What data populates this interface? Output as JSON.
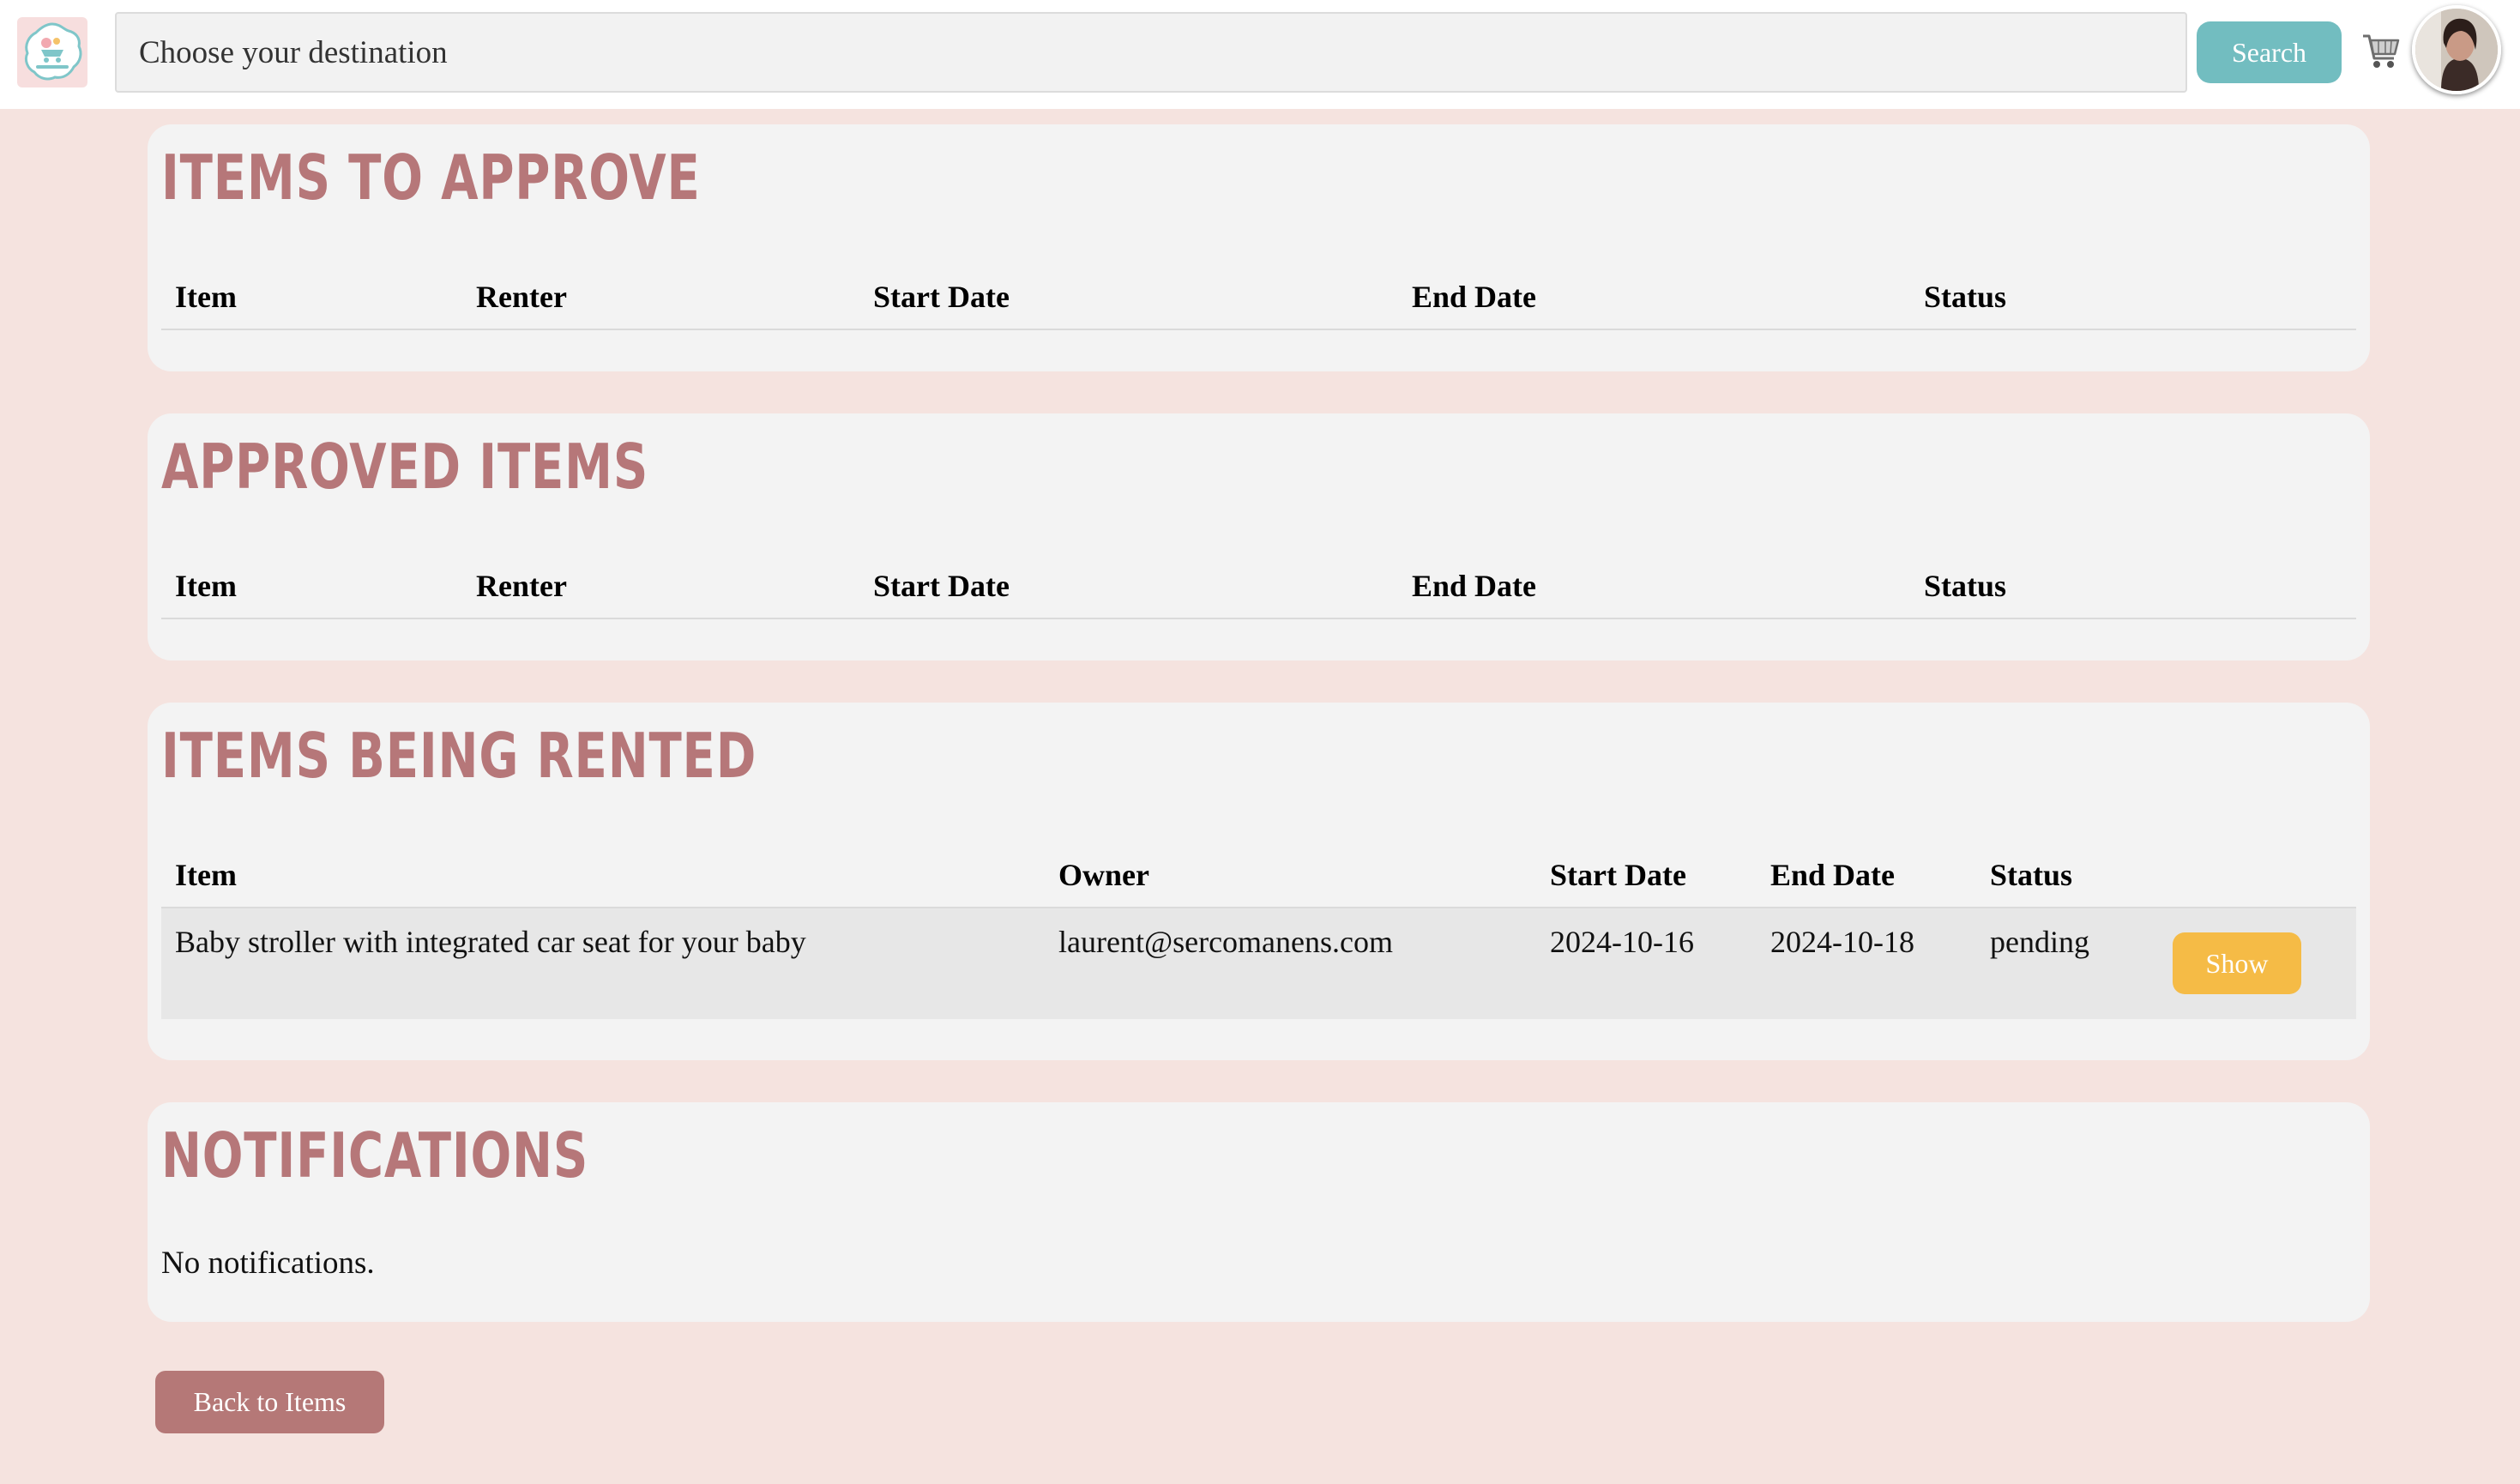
{
  "header": {
    "logo_icon": "baby-rental-logo",
    "search_placeholder": "Choose your destination",
    "search_button_label": "Search",
    "cart_icon": "cart-icon",
    "avatar_icon": "user-avatar"
  },
  "sections": {
    "to_approve": {
      "title": "Items to Approve",
      "columns": [
        "Item",
        "Renter",
        "Start Date",
        "End Date",
        "Status"
      ]
    },
    "approved": {
      "title": "Approved Items",
      "columns": [
        "Item",
        "Renter",
        "Start Date",
        "End Date",
        "Status"
      ]
    },
    "being_rented": {
      "title": "Items Being Rented",
      "columns": [
        "Item",
        "Owner",
        "Start Date",
        "End Date",
        "Status"
      ],
      "rows": [
        {
          "item": "Baby stroller with integrated car seat for your baby",
          "owner": "laurent@sercomanens.com",
          "start_date": "2024-10-16",
          "end_date": "2024-10-18",
          "status": "pending",
          "action_label": "Show"
        }
      ]
    },
    "notifications": {
      "title": "Notifications",
      "empty_text": "No notifications."
    }
  },
  "footer": {
    "back_button_label": "Back to Items"
  },
  "colors": {
    "page_background": "#f5e3df",
    "card_background": "#f3f3f3",
    "heading": "#b67779",
    "search_button": "#72bdc0",
    "show_button": "#f5bb46",
    "back_button": "#b57877"
  }
}
